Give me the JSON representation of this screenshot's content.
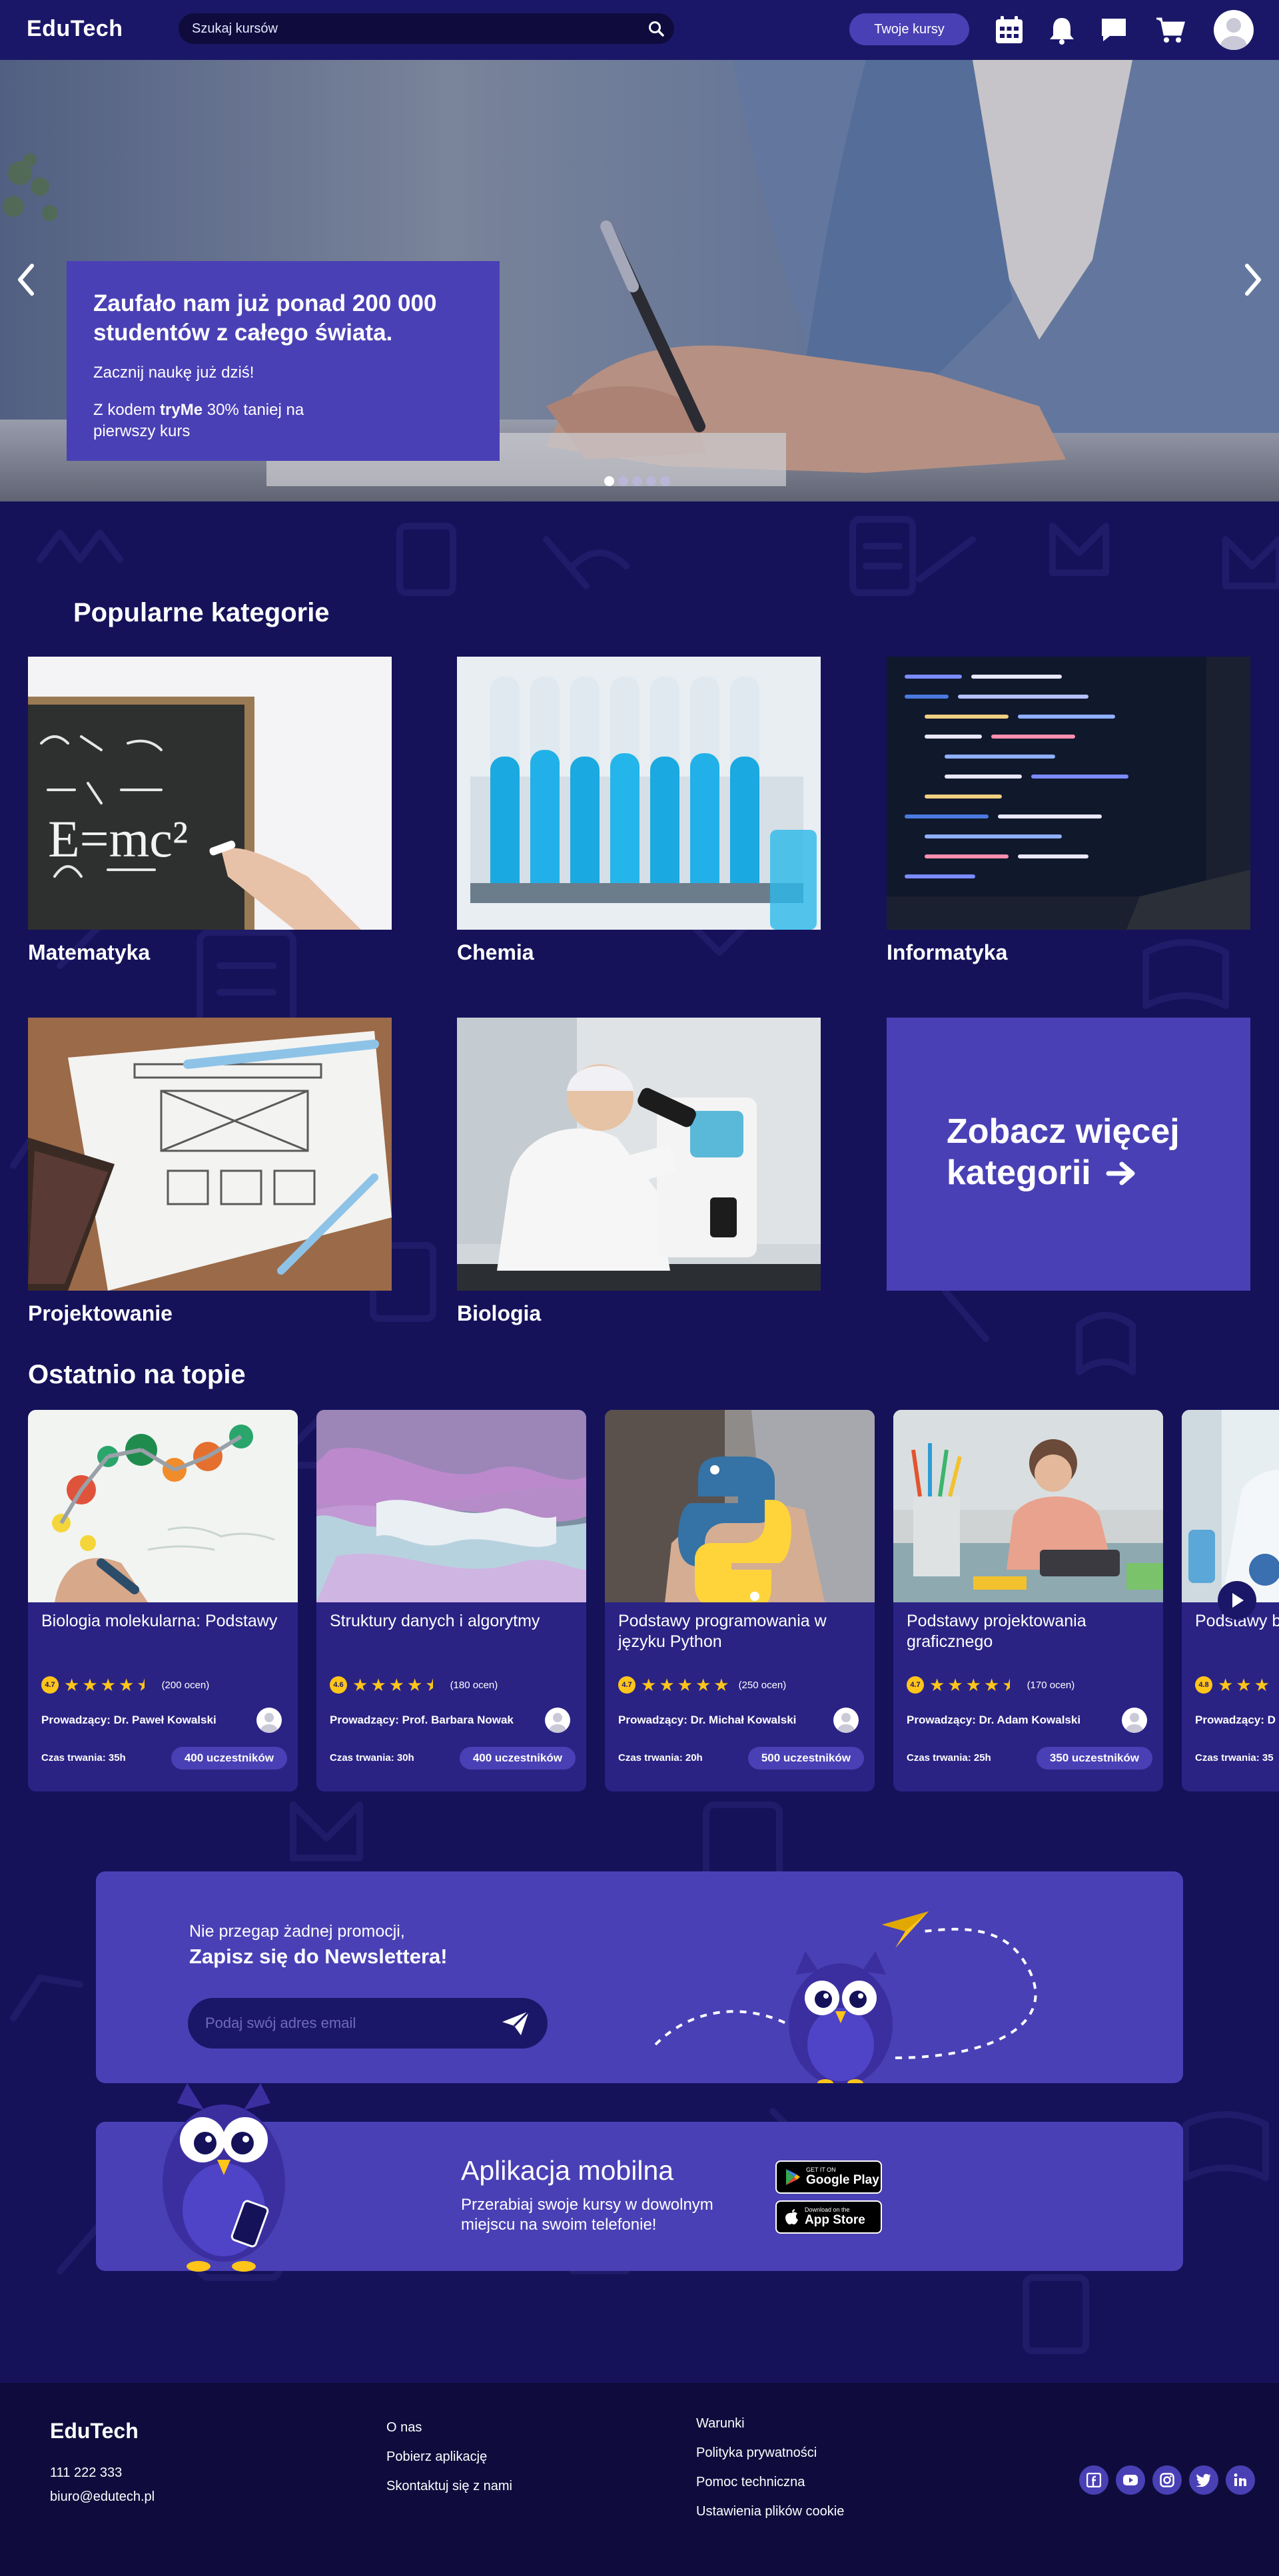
{
  "header": {
    "logo": "EduTech",
    "search_placeholder": "Szukaj kursów",
    "courses_button": "Twoje kursy",
    "icons": [
      "calendar-icon",
      "bell-icon",
      "chat-icon",
      "cart-icon",
      "user-icon"
    ]
  },
  "hero": {
    "title": "Zaufało nam już ponad 200 000 studentów z całego świata.",
    "subtitle": "Zacznij naukę już dziś!",
    "promo_before": "Z kodem ",
    "promo_code": "tryMe",
    "promo_after": " 30% taniej na pierwszy kurs",
    "slides_count": 5,
    "active_slide": 1
  },
  "categories": {
    "title": "Popularne kategorie",
    "items": [
      {
        "label": "Matematyka"
      },
      {
        "label": "Chemia"
      },
      {
        "label": "Informatyka"
      },
      {
        "label": "Projektowanie"
      },
      {
        "label": "Biologia"
      }
    ],
    "more": "Zobacz więcej kategorii"
  },
  "trending": {
    "title": "Ostatnio na topie",
    "courses": [
      {
        "title": "Biologia molekularna: Podstawy",
        "rating": "4.7",
        "stars": 4.5,
        "reviews": "(200 ocen)",
        "instructor": "Prowadzący: Dr. Paweł Kowalski",
        "duration": "Czas trwania: 35h",
        "students": "400 uczestników"
      },
      {
        "title": "Struktury danych i algorytmy",
        "rating": "4.6",
        "stars": 4.5,
        "reviews": "(180 ocen)",
        "instructor": "Prowadzący: Prof. Barbara Nowak",
        "duration": "Czas trwania: 30h",
        "students": "400 uczestników"
      },
      {
        "title": "Podstawy programowania w języku Python",
        "rating": "4.7",
        "stars": 5,
        "reviews": "(250 ocen)",
        "instructor": "Prowadzący: Dr. Michał Kowalski",
        "duration": "Czas trwania: 20h",
        "students": "500 uczestników"
      },
      {
        "title": "Podstawy projektowania graficznego",
        "rating": "4.7",
        "stars": 4.5,
        "reviews": "(170 ocen)",
        "instructor": "Prowadzący: Dr. Adam Kowalski",
        "duration": "Czas trwania: 25h",
        "students": "350 uczestników"
      },
      {
        "title": "Podstawy b",
        "rating": "4.8",
        "stars": 5,
        "reviews": "",
        "instructor": "Prowadzący: D",
        "duration": "Czas trwania: 35",
        "students": ""
      }
    ]
  },
  "newsletter": {
    "small": "Nie przegap żadnej promocji,",
    "big": "Zapisz się do Newslettera!",
    "placeholder": "Podaj swój adres email"
  },
  "app": {
    "title": "Aplikacja mobilna",
    "subtitle": "Przerabiaj swoje kursy w dowolnym miejscu na swoim telefonie!",
    "google_small": "GET IT ON",
    "google_big": "Google Play",
    "apple_small": "Download on the",
    "apple_big": "App Store"
  },
  "footer": {
    "logo": "EduTech",
    "phone": "111 222 333",
    "email": "biuro@edutech.pl",
    "col1": [
      "O nas",
      "Pobierz aplikację",
      "Skontaktuj się z nami"
    ],
    "col2": [
      "Warunki",
      "Polityka prywatności",
      "Pomoc techniczna",
      "Ustawienia plików cookie"
    ],
    "social": [
      "facebook-icon",
      "youtube-icon",
      "instagram-icon",
      "twitter-icon",
      "linkedin-icon"
    ]
  },
  "colors": {
    "background": "#15125a",
    "header": "#1b1768",
    "accent": "#4a40b5",
    "card": "#2a2384",
    "star": "#ffc51a",
    "footer": "#0f0c3d"
  }
}
